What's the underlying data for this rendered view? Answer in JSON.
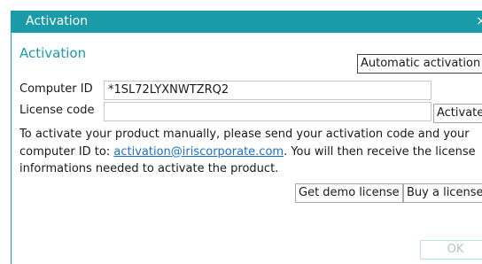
{
  "window": {
    "title": "Activation",
    "close_glyph": "×",
    "accent_color": "#1b9aa8"
  },
  "section": {
    "title": "Activation"
  },
  "buttons": {
    "automatic_activation": "Automatic activation",
    "activate": "Activate",
    "get_demo_license": "Get demo license",
    "buy_license": "Buy a license",
    "ok": "OK"
  },
  "fields": {
    "computer_id_label": "Computer ID",
    "computer_id_value": "*1SL72LYXNWTZRQ2",
    "license_code_label": "License code",
    "license_code_value": ""
  },
  "info": {
    "text_before": "To activate your product manually, please send your activation code and your computer ID to: ",
    "email": "activation@iriscorporate.com",
    "text_after": ". You will then receive the license informations needed to activate the product."
  }
}
